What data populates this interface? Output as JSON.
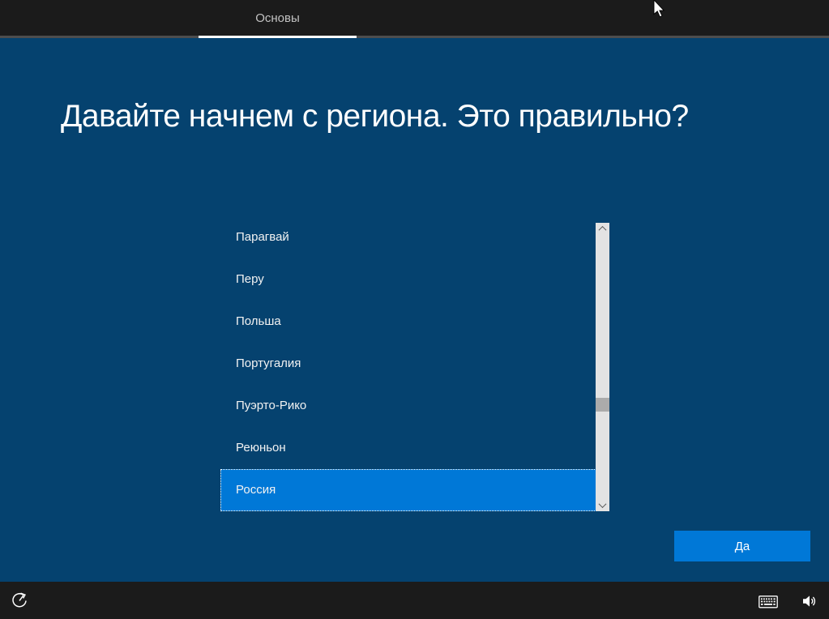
{
  "window": {
    "tab_label": "Основы"
  },
  "main": {
    "title": "Давайте начнем с региона. Это правильно?",
    "regions": [
      {
        "label": "Парагвай",
        "selected": false
      },
      {
        "label": "Перу",
        "selected": false
      },
      {
        "label": "Польша",
        "selected": false
      },
      {
        "label": "Португалия",
        "selected": false
      },
      {
        "label": "Пуэрто-Рико",
        "selected": false
      },
      {
        "label": "Реюньон",
        "selected": false
      },
      {
        "label": "Россия",
        "selected": true
      }
    ],
    "yes_button_label": "Да"
  },
  "footer": {
    "icons": [
      "ease-of-access-icon",
      "keyboard-icon",
      "volume-icon"
    ]
  },
  "colors": {
    "background": "#05426f",
    "accent": "#0078d7",
    "bar": "#1b1b1b",
    "bar_border": "#4d4d4d",
    "tab_text": "#c3c3c3",
    "scroll_track": "#e3e3e3",
    "scroll_thumb": "#ababab"
  }
}
